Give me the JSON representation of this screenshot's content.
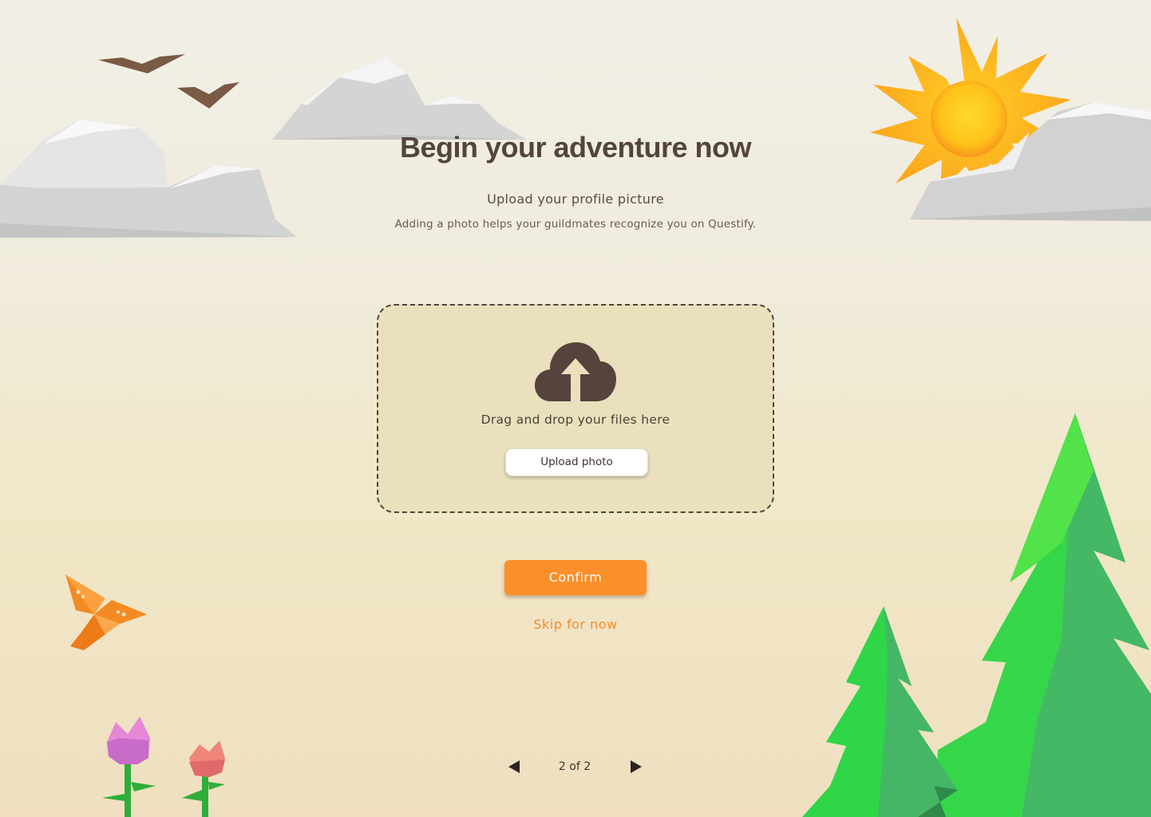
{
  "onboarding": {
    "title": "Begin your adventure now",
    "subtitle": "Upload your profile picture",
    "description": "Adding a photo helps your guildmates recognize you on Questify."
  },
  "upload": {
    "icon": "cloud-upload-icon",
    "drop_text": "Drag and drop your files here",
    "button_label": "Upload photo"
  },
  "actions": {
    "confirm_label": "Confirm",
    "skip_label": "Skip for now"
  },
  "pagination": {
    "text": "2 of 2",
    "current": 2,
    "total": 2,
    "prev_icon": "triangle-left-icon",
    "next_icon": "triangle-right-icon"
  },
  "colors": {
    "primary": "#fb8f2a",
    "text": "#54443c",
    "dropzone_bg": "#eae0bd"
  }
}
